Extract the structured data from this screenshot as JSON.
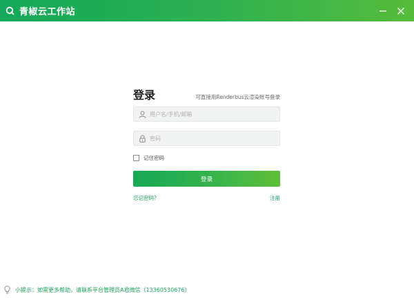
{
  "window": {
    "title": "青椒云工作站",
    "icons": {
      "logo": "q-logo-icon",
      "minimize": "minimize-icon",
      "close": "close-icon"
    }
  },
  "colors": {
    "brand_green": "#14a85a",
    "brand_lime": "#56bb3a",
    "link_green": "#1aa35a",
    "field_bg": "#f1f3f2"
  },
  "login": {
    "title": "登录",
    "hint": "可直接用Renderbus云渲染账号登录",
    "username": {
      "placeholder": "用户名/手机/邮箱",
      "value": "",
      "icon": "user-icon"
    },
    "password": {
      "placeholder": "密码",
      "value": "",
      "icon": "lock-icon"
    },
    "remember": {
      "label": "记住密码",
      "checked": false
    },
    "submit_label": "登录",
    "forgot_label": "忘记密码？",
    "register_label": "注册"
  },
  "footer": {
    "icon": "lightbulb-icon",
    "tip": "小提示：如需更多帮助，请联系平台管理员A君微信（13360530676）"
  }
}
